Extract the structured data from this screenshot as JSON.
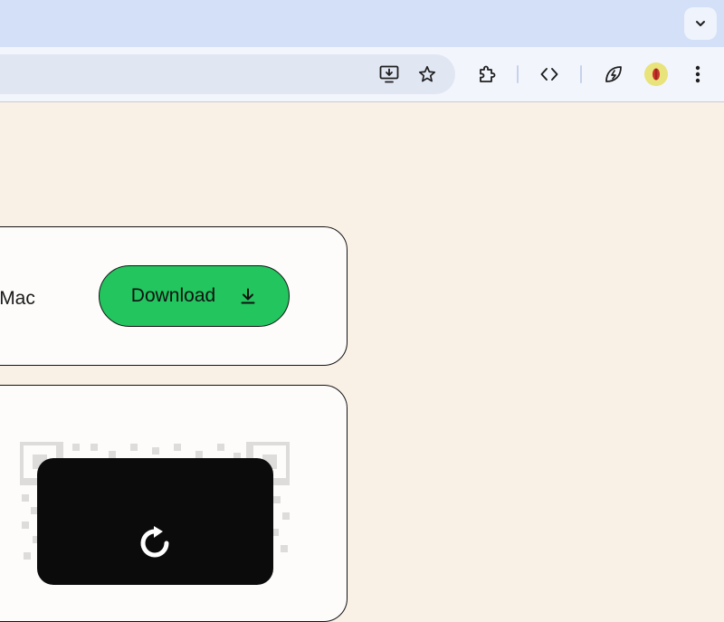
{
  "browser": {
    "tab_search_icon": "chevron-down-icon",
    "toolbar_icons": [
      "install-app-icon",
      "bookmark-star-icon",
      "extensions-icon",
      "devtools-code-icon",
      "performance-leaf-icon",
      "profile-avatar",
      "more-menu-icon"
    ]
  },
  "card1": {
    "text": "ne Mac",
    "download_label": "Download",
    "download_icon": "download-arrow-icon"
  },
  "card2": {
    "refresh_icon": "refresh-icon"
  },
  "colors": {
    "page_bg": "#f9f0e6",
    "download_button": "#22c55e",
    "tabstrip": "#d3e0f7",
    "toolbar": "#f2f5fc"
  }
}
